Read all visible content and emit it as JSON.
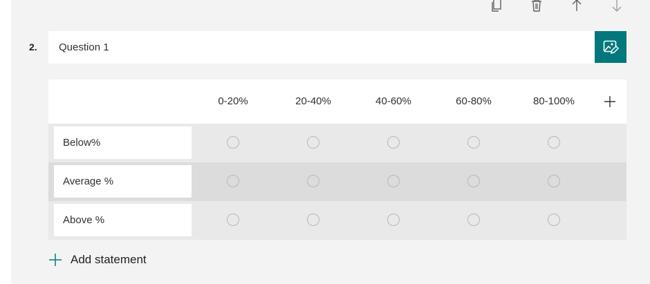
{
  "question": {
    "number": "2.",
    "title": "Question 1"
  },
  "toolbar": {
    "icons": [
      "copy-icon",
      "delete-icon",
      "move-up-icon",
      "move-down-icon"
    ]
  },
  "likert": {
    "columns": [
      "0-20%",
      "20-40%",
      "40-60%",
      "60-80%",
      "80-100%"
    ],
    "statements": [
      "Below%",
      "Average %",
      "Above %"
    ],
    "add_statement_label": "Add statement"
  },
  "colors": {
    "accent": "#03787c",
    "card_bg": "#f3f3f3",
    "row_light": "#e9e9e9",
    "row_dark": "#dcdcdc"
  }
}
